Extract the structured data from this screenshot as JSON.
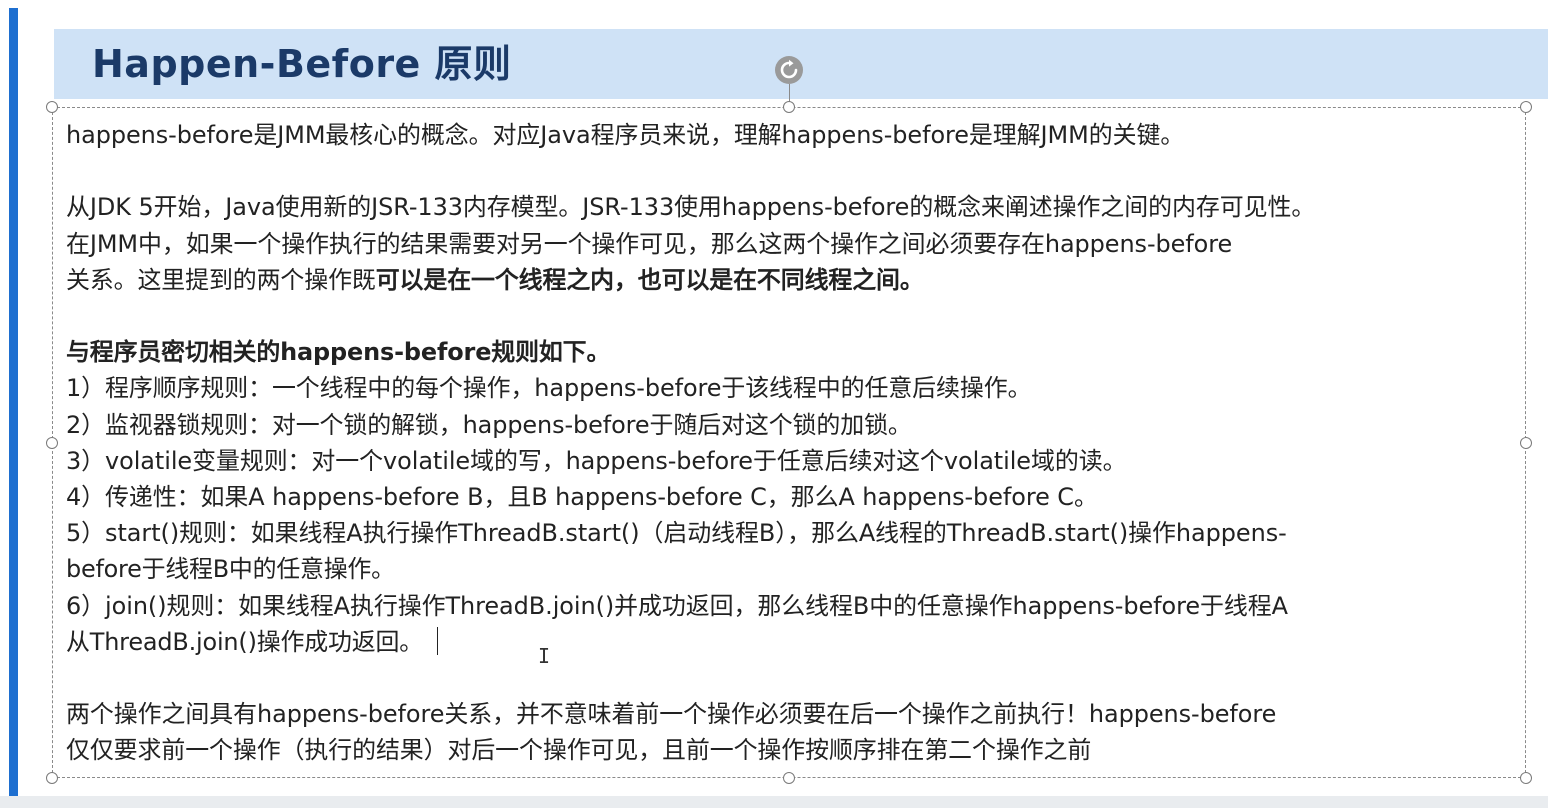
{
  "slide": {
    "title": "Happen-Before 原则",
    "accent_color": "#1e6fd0",
    "title_band_color": "#cfe2f6",
    "title_color": "#1b3a68"
  },
  "content": {
    "intro": "happens-before是JMM最核心的概念。对应Java程序员来说，理解happens-before是理解JMM的关键。",
    "jsr_paragraph": {
      "line1": "从JDK 5开始，Java使用新的JSR-133内存模型。JSR-133使用happens-before的概念来阐述操作之间的内存可见性。",
      "line2": "在JMM中，如果一个操作执行的结果需要对另一个操作可见，那么这两个操作之间必须要存在happens-before",
      "line3_normal": "关系。这里提到的两个操作既",
      "line3_bold": "可以是在一个线程之内，也可以是在不同线程之间。"
    },
    "rules_heading": "与程序员密切相关的happens-before规则如下。",
    "rules": [
      "1）程序顺序规则：一个线程中的每个操作，happens-before于该线程中的任意后续操作。",
      "2）监视器锁规则：对一个锁的解锁，happens-before于随后对这个锁的加锁。",
      "3）volatile变量规则：对一个volatile域的写，happens-before于任意后续对这个volatile域的读。",
      "4）传递性：如果A happens-before B，且B happens-before C，那么A happens-before C。"
    ],
    "rule5": {
      "line1": "5）start()规则：如果线程A执行操作ThreadB.start()（启动线程B），那么A线程的ThreadB.start()操作happens-",
      "line2": "before于线程B中的任意操作。"
    },
    "rule6": {
      "line1": "6）join()规则：如果线程A执行操作ThreadB.join()并成功返回，那么线程B中的任意操作happens-before于线程A",
      "line2": "从ThreadB.join()操作成功返回。"
    },
    "conclusion": {
      "line1": "两个操作之间具有happens-before关系，并不意味着前一个操作必须要在后一个操作之前执行！happens-before",
      "line2": "仅仅要求前一个操作（执行的结果）对后一个操作可见，且前一个操作按顺序排在第二个操作之前"
    }
  },
  "icons": {
    "rotate_handle": "rotate-icon",
    "cursor": "text-cursor-icon"
  }
}
